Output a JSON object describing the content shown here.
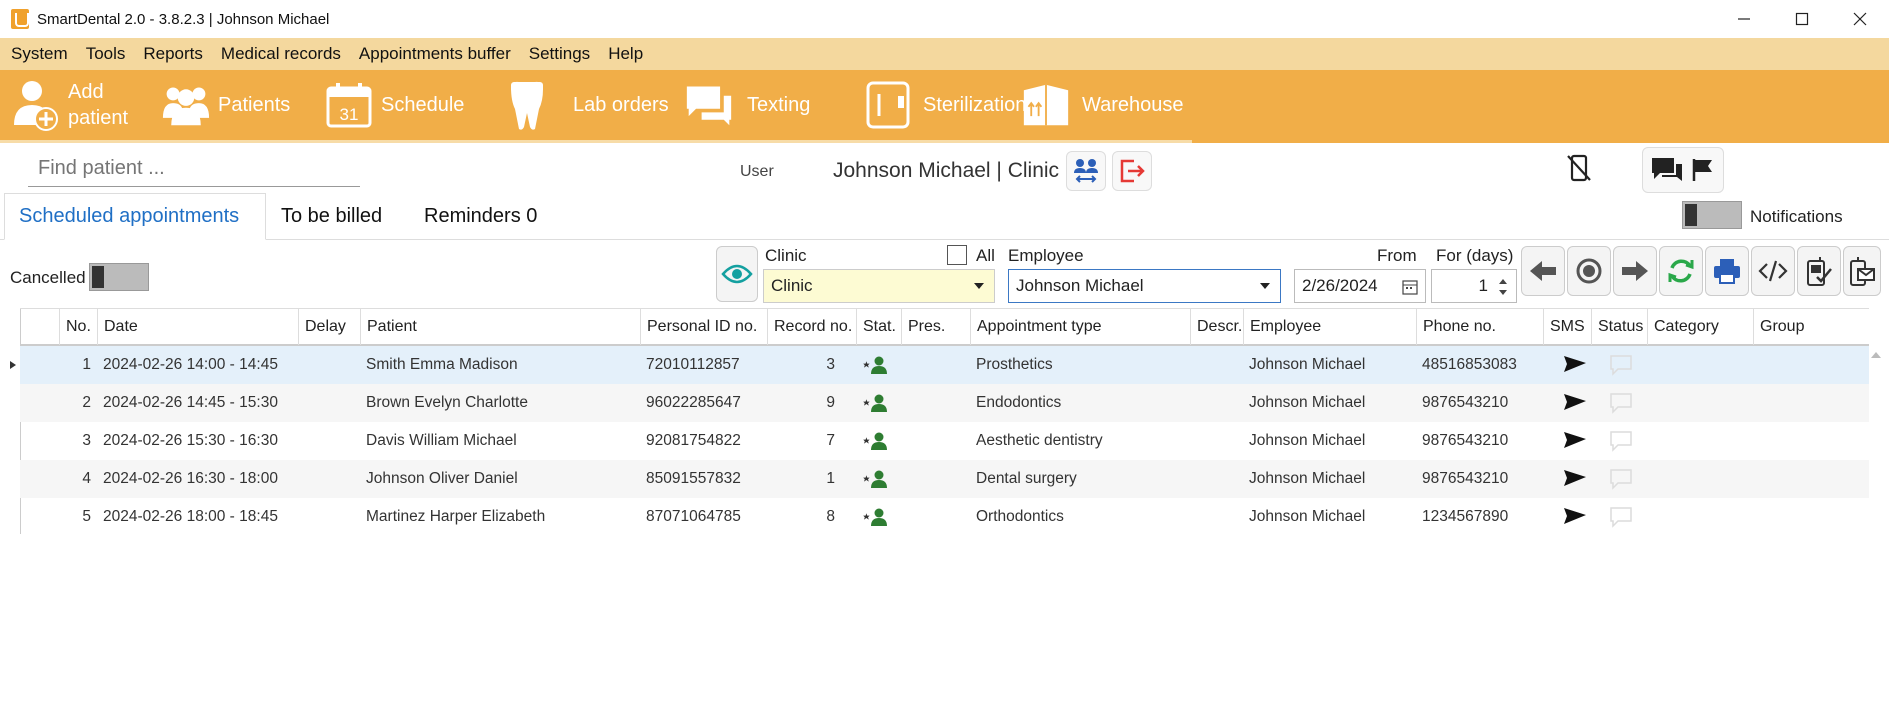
{
  "window": {
    "title": "SmartDental 2.0 - 3.8.2.3 | Johnson Michael"
  },
  "menu": [
    "System",
    "Tools",
    "Reports",
    "Medical records",
    "Appointments buffer",
    "Settings",
    "Help"
  ],
  "toolbar": {
    "add_patient_line1": "Add",
    "add_patient_line2": "patient",
    "patients": "Patients",
    "schedule": "Schedule",
    "schedule_day": "31",
    "lab_orders": "Lab orders",
    "texting": "Texting",
    "sterilization": "Sterilization",
    "warehouse": "Warehouse"
  },
  "search": {
    "placeholder": "Find patient ..."
  },
  "user": {
    "label": "User",
    "name": "Johnson Michael | Clinic"
  },
  "tabs": {
    "scheduled": "Scheduled appointments",
    "billed": "To be billed",
    "reminders": "Reminders 0"
  },
  "notifications": {
    "label": "Notifications"
  },
  "filters": {
    "cancelled_label": "Cancelled",
    "clinic_label": "Clinic",
    "clinic_value": "Clinic",
    "all_label": "All",
    "employee_label": "Employee",
    "employee_value": "Johnson Michael",
    "from_label": "From",
    "from_value": "2/26/2024",
    "days_label": "For (days)",
    "days_value": "1"
  },
  "table": {
    "columns": [
      "No.",
      "Date",
      "Delay",
      "Patient",
      "Personal ID no.",
      "Record no.",
      "Stat.",
      "Pres.",
      "Appointment type",
      "Descr.",
      "Employee",
      "Phone no.",
      "SMS",
      "Status",
      "Category",
      "Group"
    ],
    "rows": [
      {
        "no": "1",
        "date": "2024-02-26 14:00 - 14:45",
        "patient": "Smith Emma Madison",
        "pid": "72010112857",
        "record": "3",
        "type": "Prosthetics",
        "employee": "Johnson Michael",
        "phone": "48516853083"
      },
      {
        "no": "2",
        "date": "2024-02-26 14:45 - 15:30",
        "patient": "Brown Evelyn Charlotte",
        "pid": "96022285647",
        "record": "9",
        "type": "Endodontics",
        "employee": "Johnson Michael",
        "phone": "9876543210"
      },
      {
        "no": "3",
        "date": "2024-02-26 15:30 - 16:30",
        "patient": "Davis William Michael",
        "pid": "92081754822",
        "record": "7",
        "type": "Aesthetic dentistry",
        "employee": "Johnson Michael",
        "phone": "9876543210"
      },
      {
        "no": "4",
        "date": "2024-02-26 16:30 - 18:00",
        "patient": "Johnson Oliver Daniel",
        "pid": "85091557832",
        "record": "1",
        "type": "Dental surgery",
        "employee": "Johnson Michael",
        "phone": "9876543210"
      },
      {
        "no": "5",
        "date": "2024-02-26 18:00 - 18:45",
        "patient": "Martinez Harper Elizabeth",
        "pid": "87071064785",
        "record": "8",
        "type": "Orthodontics",
        "employee": "Johnson Michael",
        "phone": "1234567890"
      }
    ]
  },
  "colors": {
    "toolbar": "#f1ae48",
    "menubar": "#f4d89e",
    "accent": "#1f6fc5",
    "status_green": "#2e7d32",
    "refresh_green": "#2aa84a",
    "logout_red": "#e53935"
  }
}
